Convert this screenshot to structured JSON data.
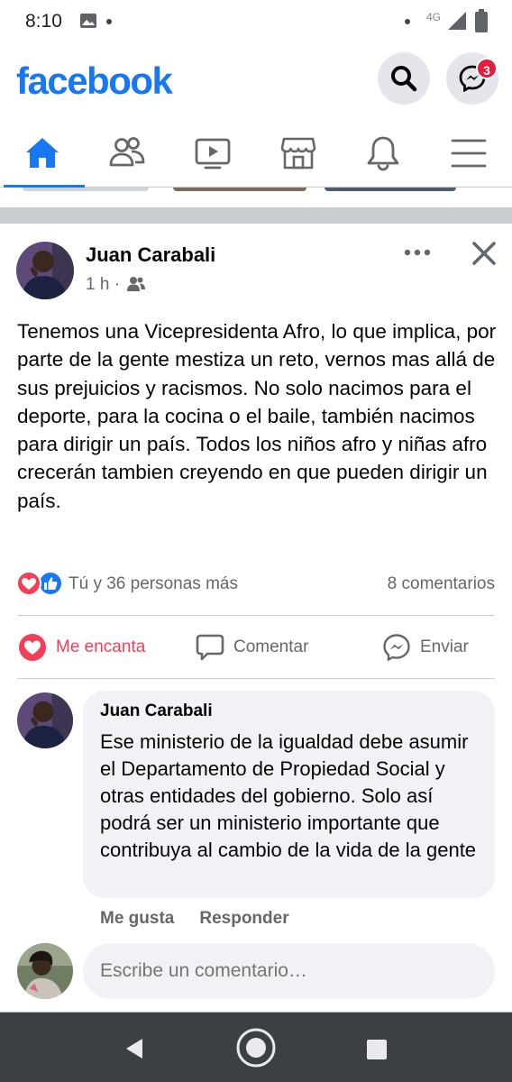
{
  "status_bar": {
    "time": "8:10",
    "network": "4G"
  },
  "header": {
    "logo": "facebook",
    "messenger_badge": "3",
    "brand_color": "#1877f2"
  },
  "nav_tabs": [
    {
      "name": "home",
      "icon": "home-icon",
      "active": true
    },
    {
      "name": "friends",
      "icon": "friends-icon",
      "active": false
    },
    {
      "name": "watch",
      "icon": "video-icon",
      "active": false
    },
    {
      "name": "marketplace",
      "icon": "marketplace-icon",
      "active": false
    },
    {
      "name": "notifications",
      "icon": "bell-icon",
      "active": false
    },
    {
      "name": "menu",
      "icon": "hamburger-menu-icon",
      "active": false
    }
  ],
  "post": {
    "author": "Juan Carabali",
    "time": "1 h",
    "separator": "·",
    "audience_icon": "friends-audience-icon",
    "text": "Tenemos una Vicepresidenta Afro, lo que implica, por parte de la gente mestiza un reto, vernos mas allá de sus prejuicios y racismos. No solo nacimos para el deporte, para la cocina o el baile, también nacimos para dirigir un país. Todos los niños afro y niñas afro crecerán tambien creyendo en que pueden dirigir un país.",
    "reactions_text": "Tú y 36 personas más",
    "comments_count": "8 comentarios",
    "actions": {
      "love": "Me encanta",
      "comment": "Comentar",
      "send": "Enviar"
    },
    "love_color": "#f33e58"
  },
  "comment": {
    "author": "Juan Carabali",
    "text": "Ese ministerio de la igualdad debe asumir el Departamento de Propiedad Social y otras entidades del gobierno. Solo así podrá ser un ministerio importante que contribuya al cambio de la vida de la gente",
    "like_label": "Me gusta",
    "reply_label": "Responder"
  },
  "composer": {
    "placeholder": "Escribe un comentario…"
  }
}
